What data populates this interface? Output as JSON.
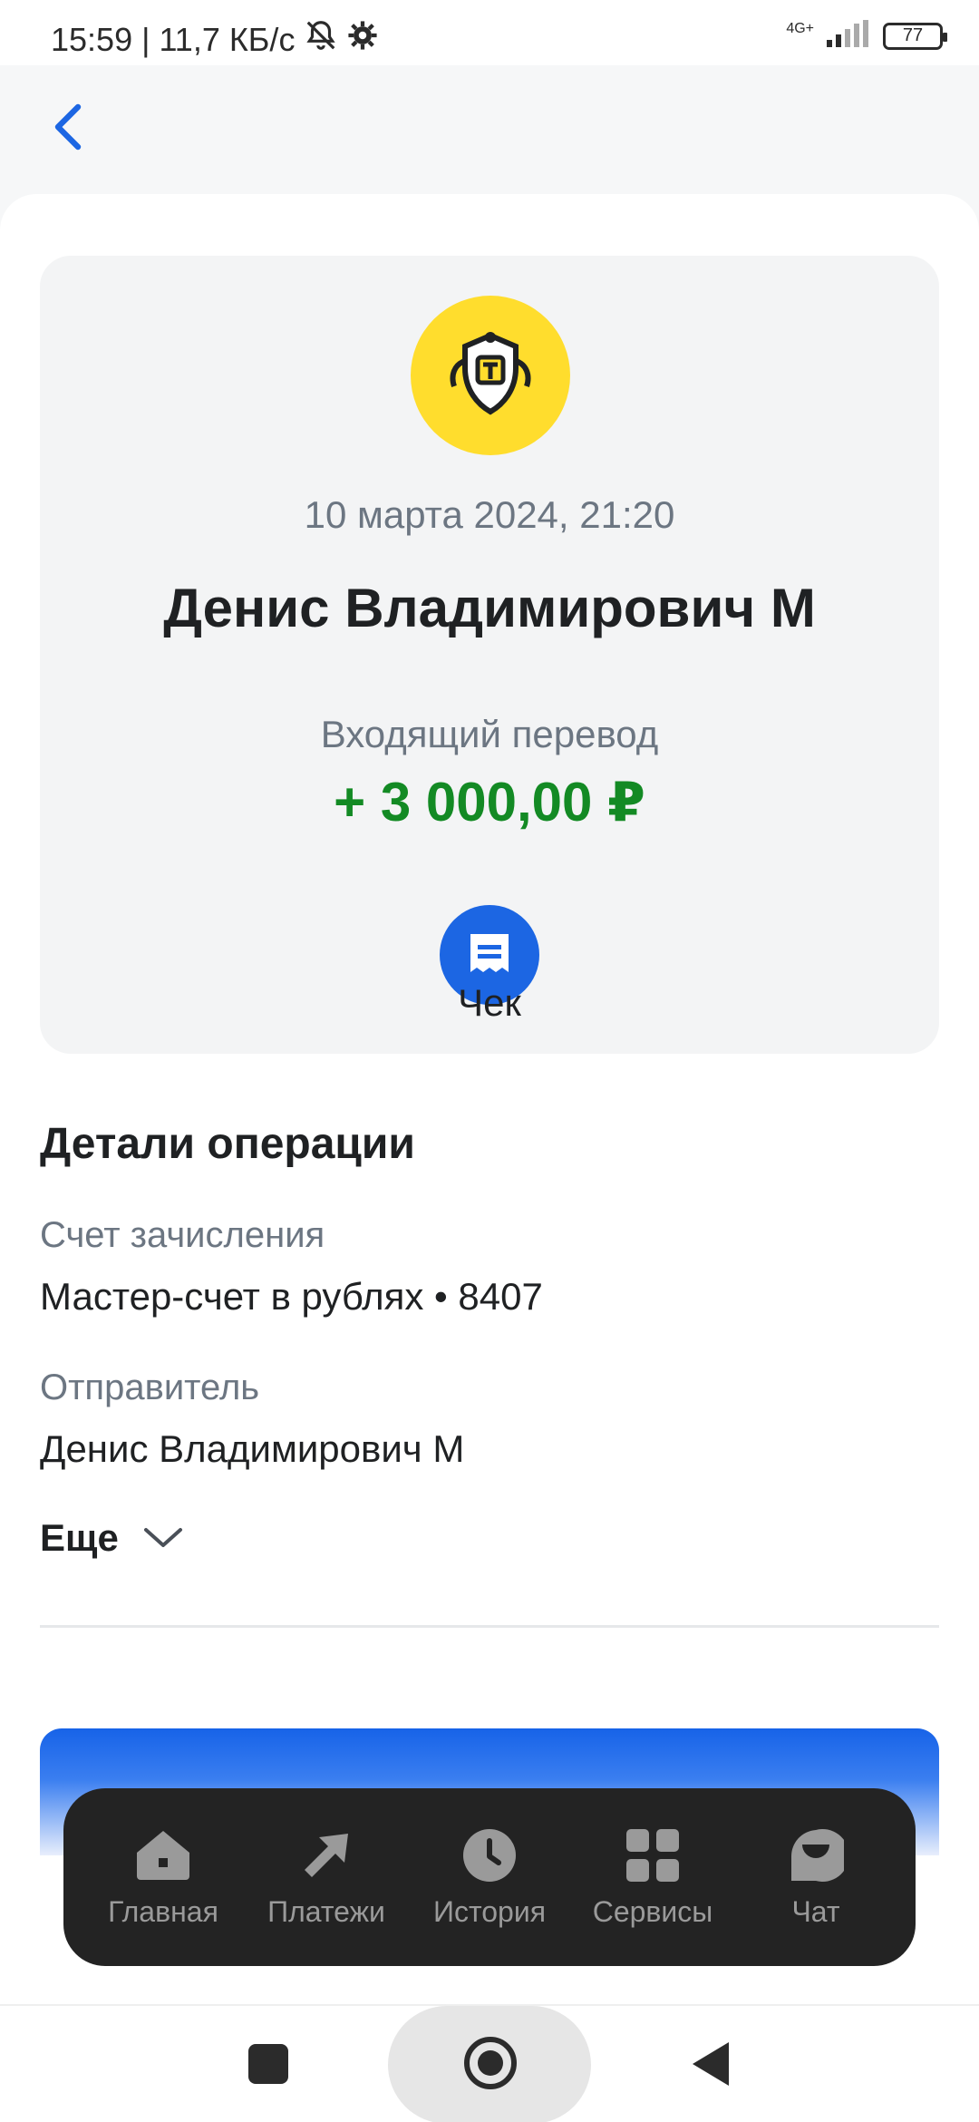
{
  "status_bar": {
    "time_and_speed": "15:59 | 11,7 КБ/с",
    "network": "4G+",
    "battery": "77"
  },
  "operation": {
    "date": "10 марта 2024, 21:20",
    "counterparty": "Денис Владимирович М",
    "type": "Входящий перевод",
    "amount": "+ 3 000,00 ₽",
    "receipt_label": "Чек"
  },
  "details": {
    "title": "Детали операции",
    "account_label": "Счет зачисления",
    "account_value": "Мастер-счет в рублях • 8407",
    "sender_label": "Отправитель",
    "sender_value": "Денис Владимирович М",
    "more_label": "Еще"
  },
  "tab_bar": {
    "items": [
      {
        "label": "Главная",
        "icon": "home-icon"
      },
      {
        "label": "Платежи",
        "icon": "payments-arrow-icon"
      },
      {
        "label": "История",
        "icon": "clock-icon"
      },
      {
        "label": "Сервисы",
        "icon": "grid-icon"
      },
      {
        "label": "Чат",
        "icon": "chat-smile-icon"
      }
    ]
  },
  "colors": {
    "accent_blue": "#1c66e3",
    "amount_green": "#138a24",
    "logo_yellow": "#ffdd2d",
    "tab_bar_bg": "#232323"
  }
}
